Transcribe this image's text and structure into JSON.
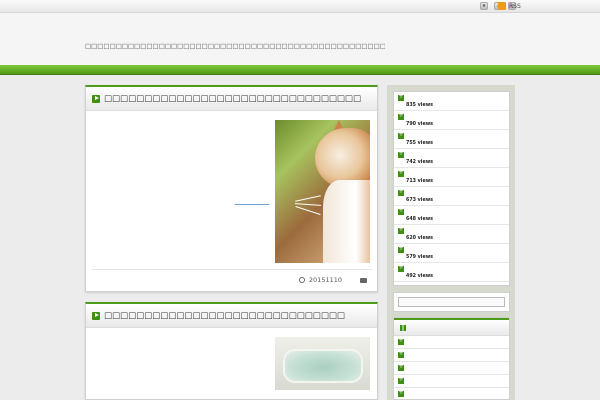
{
  "topbar": {
    "icons": [
      "bookmark-icon",
      "download-icon",
      "feed-icon"
    ],
    "rss_label": "RSS"
  },
  "header": {
    "tagline": "□□□□□□□□□□□□□□□□□□□□□□□□□□□□□□□□□□□□□□□□□□□□□□□□□□□□□□□□□□□□□□"
  },
  "posts": [
    {
      "title": "□□□□□□□□□□□□□□□□□□□□□□□□□□□□□□□□",
      "date": "20151110",
      "image": "cat-photo"
    },
    {
      "title": "□□□□□□□□□□□□□□□□□□□□□□□□□□□□□□",
      "image": "bathtub-photo"
    }
  ],
  "sidebar": {
    "ranking": [
      {
        "views": "835 views"
      },
      {
        "views": "790 views"
      },
      {
        "views": "755 views"
      },
      {
        "views": "742 views"
      },
      {
        "views": "713 views"
      },
      {
        "views": "673 views"
      },
      {
        "views": "648 views"
      },
      {
        "views": "620 views"
      },
      {
        "views": "579 views"
      },
      {
        "views": "492 views"
      }
    ],
    "search": {
      "placeholder": ""
    },
    "categories_count": 5
  },
  "colors": {
    "accent_green": "#4e9b17",
    "header_bar": "#7fc63a",
    "sidebar_bg": "#d6d9cd"
  }
}
